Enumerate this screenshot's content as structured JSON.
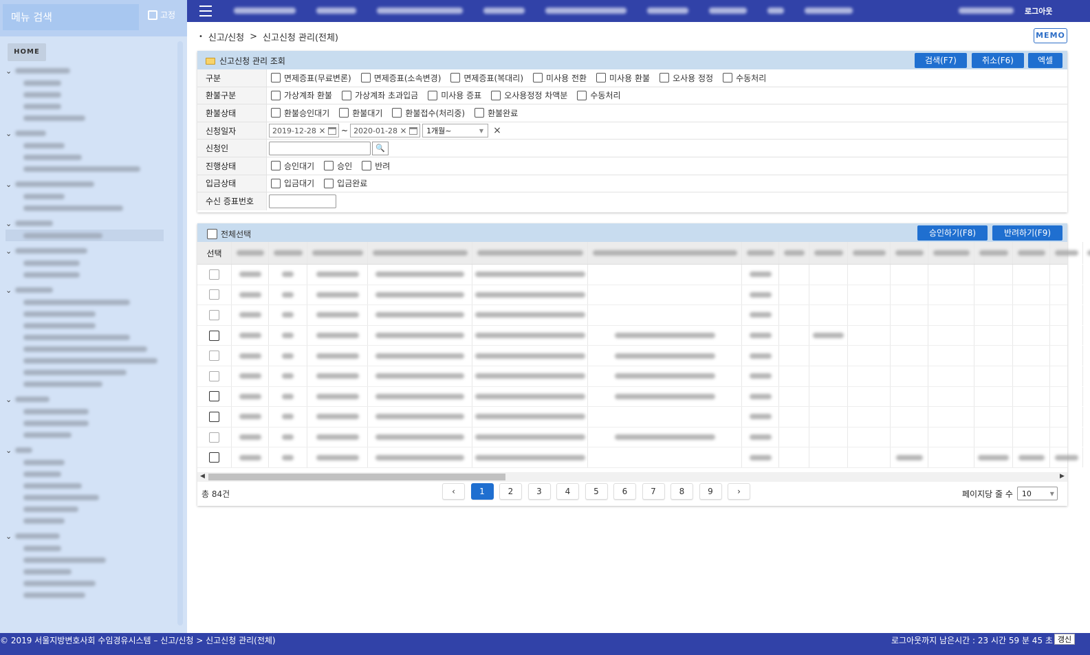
{
  "sidebar": {
    "search_placeholder": "메뉴 검색",
    "pin_label": "고정",
    "home_label": "HOME"
  },
  "topbar": {
    "logout_label": "로그아웃"
  },
  "breadcrumb": {
    "parent": "신고/신청",
    "current": "신고신청 관리(전체)"
  },
  "memo_label": "MEMO",
  "search_panel": {
    "title": "신고신청 관리 조회",
    "buttons": {
      "search": "검색(F7)",
      "cancel": "취소(F6)",
      "excel": "엑셀"
    },
    "rows": {
      "gubun": {
        "label": "구분",
        "options": [
          "면제증표(무료변론)",
          "면제증표(소속변경)",
          "면제증표(복대리)",
          "미사용 전환",
          "미사용 환불",
          "오사용 정정",
          "수동처리"
        ]
      },
      "refund_type": {
        "label": "환불구분",
        "options": [
          "가상계좌 환불",
          "가상계좌 초과입금",
          "미사용 증표",
          "오사용정정 차액분",
          "수동처리"
        ]
      },
      "refund_status": {
        "label": "환불상태",
        "options": [
          "환불승인대기",
          "환불대기",
          "환불접수(처리중)",
          "환불완료"
        ]
      },
      "apply_date": {
        "label": "신청일자",
        "from": "2019-12-28",
        "to": "2020-01-28",
        "tilde": "~",
        "period": "1개월~"
      },
      "applicant": {
        "label": "신청인",
        "value": ""
      },
      "progress": {
        "label": "진행상태",
        "options": [
          "승인대기",
          "승인",
          "반려"
        ]
      },
      "deposit": {
        "label": "입금상태",
        "options": [
          "입금대기",
          "입금완료"
        ]
      },
      "receipt_no": {
        "label": "수신 증표번호",
        "value": ""
      }
    }
  },
  "grid": {
    "select_all_label": "전체선택",
    "approve_label": "승인하기(F8)",
    "reject_label": "반려하기(F9)",
    "select_header": "선택",
    "total_text": "총 84건",
    "pages": [
      "1",
      "2",
      "3",
      "4",
      "5",
      "6",
      "7",
      "8",
      "9"
    ],
    "active_page": "1",
    "per_page_label": "페이지당 줄 수",
    "per_page_value": "10"
  },
  "footer": {
    "copyright": "© 2019 서울지방변호사회 수임경유시스템 – 신고/신청 > 신고신청 관리(전체)",
    "remaining": "로그아웃까지 남은시간 : 23 시간 59 분 45 초",
    "renew_label": "갱신"
  }
}
